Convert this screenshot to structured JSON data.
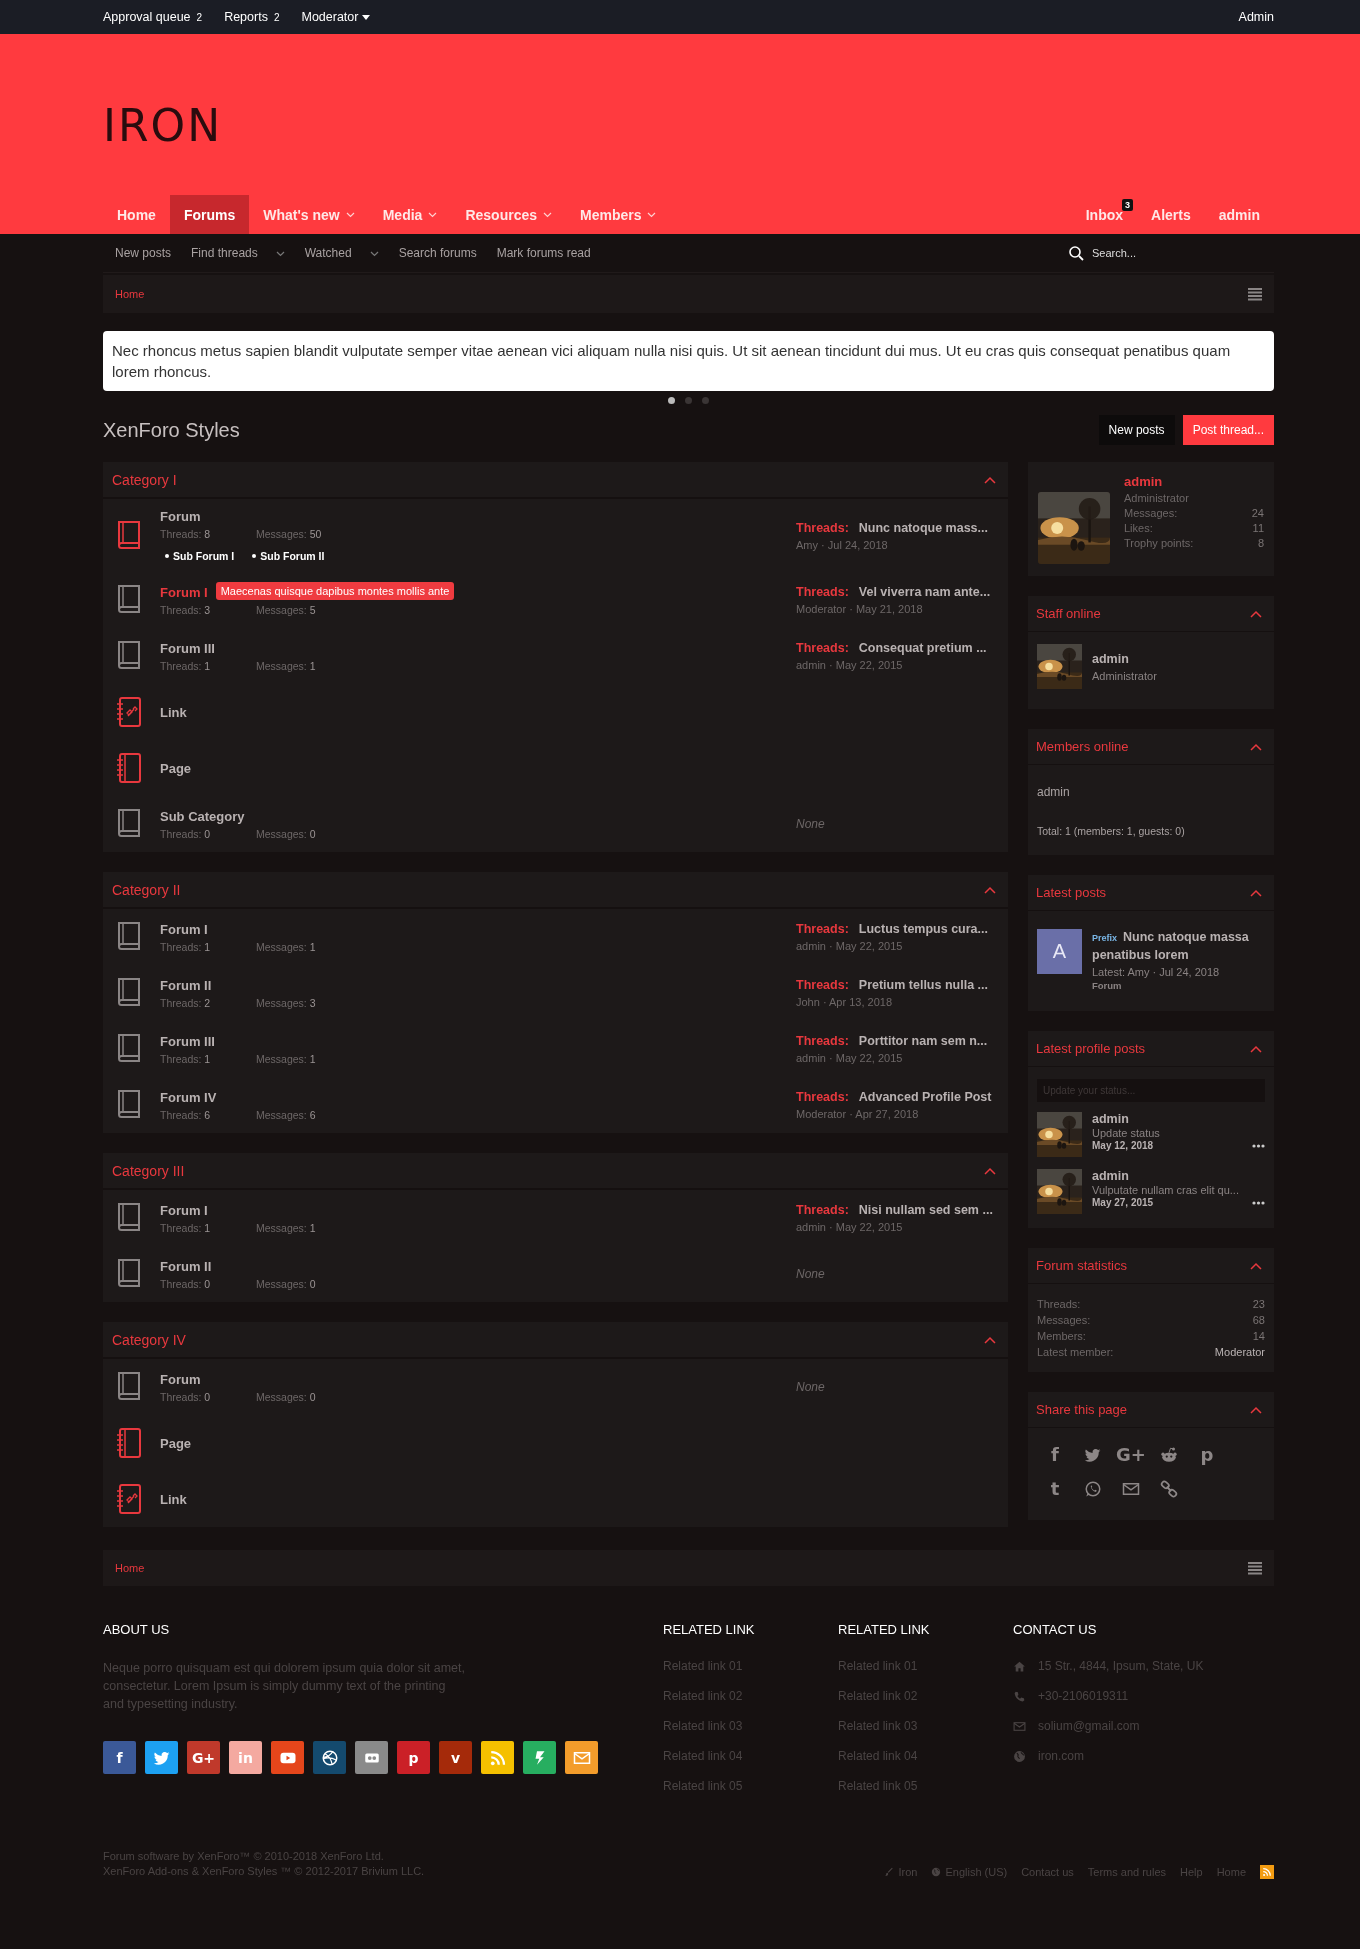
{
  "top_bar": {
    "links": [
      {
        "label": "Approval queue",
        "count": "2"
      },
      {
        "label": "Reports",
        "count": "2"
      }
    ],
    "menu": "Moderator",
    "account": "Admin"
  },
  "logo": "IRON",
  "nav": {
    "tabs": [
      {
        "label": "Home",
        "selected": false,
        "dropdown": false
      },
      {
        "label": "Forums",
        "selected": true,
        "dropdown": false
      },
      {
        "label": "What's new",
        "selected": false,
        "dropdown": true
      },
      {
        "label": "Media",
        "selected": false,
        "dropdown": true
      },
      {
        "label": "Resources",
        "selected": false,
        "dropdown": true
      },
      {
        "label": "Members",
        "selected": false,
        "dropdown": true
      }
    ],
    "account": [
      {
        "label": "Inbox",
        "badge": "3"
      },
      {
        "label": "Alerts"
      },
      {
        "label": "admin"
      }
    ]
  },
  "sub_nav": {
    "links": [
      {
        "label": "New posts",
        "dropdown": false
      },
      {
        "label": "Find threads",
        "dropdown": true
      },
      {
        "label": "Watched",
        "dropdown": true
      },
      {
        "label": "Search forums",
        "dropdown": false
      },
      {
        "label": "Mark forums read",
        "dropdown": false
      }
    ],
    "search": {
      "placeholder": "Search..."
    }
  },
  "breadcrumb": [
    "Home"
  ],
  "notice": {
    "text": "Nec rhoncus metus sapien blandit vulputate semper vitae aenean vici aliquam nulla nisi quis. Ut sit aenean tincidunt dui mus. Ut eu cras quis consequat penatibus quam lorem rhoncus.",
    "dots": [
      {
        "selected": true
      },
      {
        "selected": false
      },
      {
        "selected": false
      }
    ]
  },
  "page": {
    "title": "XenForo Styles",
    "buttons": [
      {
        "label": "New posts",
        "kind": "secondary"
      },
      {
        "label": "Post thread...",
        "kind": "primary"
      }
    ]
  },
  "categories": [
    {
      "title": "Category I",
      "nodes": [
        {
          "kind": "forum",
          "unread": true,
          "highlighted": false,
          "title": "Forum",
          "stats": [
            {
              "label": "Threads:",
              "value": "8"
            },
            {
              "label": "Messages:",
              "value": "50"
            }
          ],
          "subforums": [
            "Sub Forum I",
            "Sub Forum II"
          ],
          "latest": {
            "label": "Threads:",
            "title": "Nunc natoque mass...",
            "meta": "Amy · Jul 24, 2018"
          }
        },
        {
          "kind": "forum",
          "unread": false,
          "highlighted": true,
          "tooltip": "Maecenas quisque dapibus montes mollis ante",
          "title": "Forum I",
          "stats": [
            {
              "label": "Threads:",
              "value": "3"
            },
            {
              "label": "Messages:",
              "value": "5"
            }
          ],
          "latest": {
            "label": "Threads:",
            "title": "Vel viverra nam ante...",
            "meta": "Moderator · May 21, 2018"
          }
        },
        {
          "kind": "forum",
          "unread": false,
          "highlighted": false,
          "title": "Forum III",
          "stats": [
            {
              "label": "Threads:",
              "value": "1"
            },
            {
              "label": "Messages:",
              "value": "1"
            }
          ],
          "latest": {
            "label": "Threads:",
            "title": "Consequat pretium ...",
            "meta": "admin · May 22, 2015"
          }
        },
        {
          "kind": "link",
          "title": "Link"
        },
        {
          "kind": "page",
          "title": "Page"
        },
        {
          "kind": "forum",
          "unread": false,
          "highlighted": false,
          "title": "Sub Category",
          "stats": [
            {
              "label": "Threads:",
              "value": "0"
            },
            {
              "label": "Messages:",
              "value": "0"
            }
          ],
          "none": "None"
        }
      ]
    },
    {
      "title": "Category II",
      "nodes": [
        {
          "kind": "forum",
          "unread": false,
          "highlighted": false,
          "title": "Forum I",
          "stats": [
            {
              "label": "Threads:",
              "value": "1"
            },
            {
              "label": "Messages:",
              "value": "1"
            }
          ],
          "latest": {
            "label": "Threads:",
            "title": "Luctus tempus cura...",
            "meta": "admin · May 22, 2015"
          }
        },
        {
          "kind": "forum",
          "unread": false,
          "highlighted": false,
          "title": "Forum II",
          "stats": [
            {
              "label": "Threads:",
              "value": "2"
            },
            {
              "label": "Messages:",
              "value": "3"
            }
          ],
          "latest": {
            "label": "Threads:",
            "title": "Pretium tellus nulla ...",
            "meta": "John · Apr 13, 2018"
          }
        },
        {
          "kind": "forum",
          "unread": false,
          "highlighted": false,
          "title": "Forum III",
          "stats": [
            {
              "label": "Threads:",
              "value": "1"
            },
            {
              "label": "Messages:",
              "value": "1"
            }
          ],
          "latest": {
            "label": "Threads:",
            "title": "Porttitor nam sem n...",
            "meta": "admin · May 22, 2015"
          }
        },
        {
          "kind": "forum",
          "unread": false,
          "highlighted": false,
          "title": "Forum IV",
          "stats": [
            {
              "label": "Threads:",
              "value": "6"
            },
            {
              "label": "Messages:",
              "value": "6"
            }
          ],
          "latest": {
            "label": "Threads:",
            "title": "Advanced Profile Post",
            "meta": "Moderator · Apr 27, 2018"
          }
        }
      ]
    },
    {
      "title": "Category III",
      "nodes": [
        {
          "kind": "forum",
          "unread": false,
          "highlighted": false,
          "title": "Forum I",
          "stats": [
            {
              "label": "Threads:",
              "value": "1"
            },
            {
              "label": "Messages:",
              "value": "1"
            }
          ],
          "latest": {
            "label": "Threads:",
            "title": "Nisi nullam sed sem ...",
            "meta": "admin · May 22, 2015"
          }
        },
        {
          "kind": "forum",
          "unread": false,
          "highlighted": false,
          "title": "Forum II",
          "stats": [
            {
              "label": "Threads:",
              "value": "0"
            },
            {
              "label": "Messages:",
              "value": "0"
            }
          ],
          "none": "None"
        }
      ]
    },
    {
      "title": "Category IV",
      "nodes": [
        {
          "kind": "forum",
          "unread": false,
          "highlighted": false,
          "title": "Forum",
          "stats": [
            {
              "label": "Threads:",
              "value": "0"
            },
            {
              "label": "Messages:",
              "value": "0"
            }
          ],
          "none": "None"
        },
        {
          "kind": "page",
          "title": "Page"
        },
        {
          "kind": "link",
          "title": "Link"
        }
      ]
    }
  ],
  "sidebar": {
    "profile": {
      "name": "admin",
      "role": "Administrator",
      "stats": [
        {
          "label": "Messages:",
          "value": "24"
        },
        {
          "label": "Likes:",
          "value": "11"
        },
        {
          "label": "Trophy points:",
          "value": "8"
        }
      ]
    },
    "widgets": [
      {
        "kind": "staff",
        "title": "Staff online",
        "members": [
          {
            "name": "admin",
            "role": "Administrator"
          }
        ]
      },
      {
        "kind": "members",
        "title": "Members online",
        "names": [
          "admin"
        ],
        "total": "Total: 1 (members: 1, guests: 0)"
      },
      {
        "kind": "latest_posts",
        "title": "Latest posts",
        "posts": [
          {
            "avatar": "A",
            "prefix": "Prefix",
            "title": "Nunc natoque massa penatibus lorem",
            "meta": "Latest: Amy · Jul 24, 2018",
            "forum": "Forum"
          }
        ]
      },
      {
        "kind": "profile_posts",
        "title": "Latest profile posts",
        "placeholder": "Update your status...",
        "posts": [
          {
            "name": "admin",
            "text": "Update status",
            "date": "May 12, 2018"
          },
          {
            "name": "admin",
            "text": "Vulputate nullam cras elit qu...",
            "date": "May 27, 2015"
          }
        ]
      },
      {
        "kind": "stats",
        "title": "Forum statistics",
        "rows": [
          {
            "label": "Threads:",
            "value": "23"
          },
          {
            "label": "Messages:",
            "value": "68"
          },
          {
            "label": "Members:",
            "value": "14"
          },
          {
            "label": "Latest member:",
            "value": "Moderator"
          }
        ]
      },
      {
        "kind": "share",
        "title": "Share this page",
        "icons": [
          {
            "kind": "glyph",
            "glyph": "f"
          },
          {
            "kind": "bird"
          },
          {
            "kind": "glyph",
            "glyph": "G+"
          },
          {
            "kind": "robot"
          },
          {
            "kind": "glyph",
            "glyph": "p"
          },
          {
            "kind": "glyph",
            "glyph": "t"
          },
          {
            "kind": "phone"
          },
          {
            "kind": "mail"
          },
          {
            "kind": "chain"
          }
        ]
      }
    ]
  },
  "footer_breadcrumb": [
    "Home"
  ],
  "footer": {
    "about": {
      "heading": "ABOUT US",
      "text": "Neque porro quisquam est qui dolorem ipsum quia dolor sit amet, consectetur. Lorem Ipsum is simply dummy text of the printing and typesetting industry.",
      "social": [
        {
          "kind": "glyph",
          "glyph": "f",
          "color": "#3b5998"
        },
        {
          "kind": "bird",
          "color": "#1da1f2"
        },
        {
          "kind": "glyph",
          "glyph": "G+",
          "color": "#c0392b"
        },
        {
          "kind": "glyph",
          "glyph": "in",
          "color": "#f4a9a0"
        },
        {
          "kind": "play",
          "color": "#e5461b"
        },
        {
          "kind": "ball",
          "color": "#144a6e"
        },
        {
          "kind": "dots",
          "color": "#8a8a8a"
        },
        {
          "kind": "glyph",
          "glyph": "p",
          "color": "#cb2027"
        },
        {
          "kind": "glyph",
          "glyph": "v",
          "color": "#a52a0a"
        },
        {
          "kind": "rss",
          "color": "#f5c000"
        },
        {
          "kind": "bolt",
          "color": "#27ae60"
        },
        {
          "kind": "mail",
          "color": "#f39c2b"
        }
      ]
    },
    "columns": [
      {
        "heading": "RELATED LINK",
        "links": [
          "Related link 01",
          "Related link 02",
          "Related link 03",
          "Related link 04",
          "Related link 05"
        ]
      },
      {
        "heading": "RELATED LINK",
        "links": [
          "Related link 01",
          "Related link 02",
          "Related link 03",
          "Related link 04",
          "Related link 05"
        ]
      }
    ],
    "contact": {
      "heading": "CONTACT US",
      "items": [
        {
          "kind": "home",
          "text": "15 Str., 4844, Ipsum, State, UK"
        },
        {
          "kind": "phone",
          "text": "+30-2106019311"
        },
        {
          "kind": "mail",
          "text": "solium@gmail.com"
        },
        {
          "kind": "globe",
          "text": "iron.com"
        }
      ]
    },
    "copyright": [
      "Forum software by XenForo™ © 2010-2018 XenForo Ltd.",
      "XenForo Add-ons & XenForo Styles ™ © 2012-2017 Brivium LLC."
    ],
    "links": [
      {
        "kind": "brush",
        "label": "Iron"
      },
      {
        "kind": "globe",
        "label": "English (US)"
      },
      {
        "kind": "plain",
        "label": "Contact us"
      },
      {
        "kind": "plain",
        "label": "Terms and rules"
      },
      {
        "kind": "plain",
        "label": "Help"
      },
      {
        "kind": "plain",
        "label": "Home"
      },
      {
        "kind": "rss"
      }
    ]
  }
}
